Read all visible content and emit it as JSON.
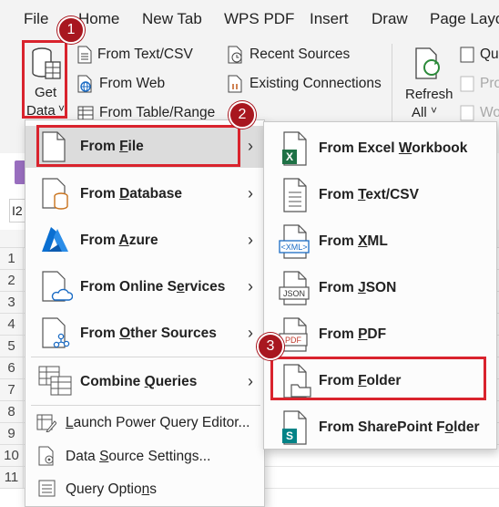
{
  "menu_tabs": [
    "File",
    "Home",
    "New Tab",
    "WPS PDF",
    "Insert",
    "Draw",
    "Page Layo"
  ],
  "ribbon": {
    "get_data": {
      "line1": "Get",
      "line2": "Data",
      "caret": "˅"
    },
    "from_text_csv": "From Text/CSV",
    "from_web": "From Web",
    "from_table_range": "From Table/Range",
    "recent_sources": "Recent Sources",
    "existing_connections": "Existing Connections",
    "refresh": {
      "line1": "Refresh",
      "line2": "All",
      "caret": "˅"
    },
    "right_items": [
      "Qu",
      "Pro",
      "Wo"
    ]
  },
  "sheet": {
    "name_box_partial": "I2",
    "row_numbers": [
      "1",
      "2",
      "3",
      "4",
      "5",
      "6",
      "7",
      "8",
      "9",
      "10",
      "11"
    ]
  },
  "get_data_menu": {
    "items": [
      {
        "pre": "From ",
        "ul": "F",
        "post": "ile"
      },
      {
        "pre": "From ",
        "ul": "D",
        "post": "atabase"
      },
      {
        "pre": "From ",
        "ul": "A",
        "post": "zure"
      },
      {
        "pre": "From Online S",
        "ul": "e",
        "post": "rvices"
      },
      {
        "pre": "From ",
        "ul": "O",
        "post": "ther Sources"
      },
      {
        "pre": "Combine ",
        "ul": "Q",
        "post": "ueries"
      }
    ],
    "bottom_items": [
      {
        "pre": "",
        "ul": "L",
        "post": "aunch Power Query Editor..."
      },
      {
        "pre": "Data ",
        "ul": "S",
        "post": "ource Settings..."
      },
      {
        "pre": "Query Optio",
        "ul": "n",
        "post": "s"
      }
    ]
  },
  "from_file_menu": {
    "items": [
      {
        "pre": "From Excel ",
        "ul": "W",
        "post": "orkbook"
      },
      {
        "pre": "From ",
        "ul": "T",
        "post": "ext/CSV"
      },
      {
        "pre": "From ",
        "ul": "X",
        "post": "ML"
      },
      {
        "pre": "From ",
        "ul": "J",
        "post": "SON"
      },
      {
        "pre": "From ",
        "ul": "P",
        "post": "DF"
      },
      {
        "pre": "From ",
        "ul": "F",
        "post": "older"
      },
      {
        "pre": "From SharePoint F",
        "ul": "o",
        "post": "lder"
      }
    ],
    "badges": {
      "xml": "<XML>",
      "json": "JSON",
      "pdf": "PDF",
      "excel": "X",
      "sharepoint": "S"
    }
  },
  "callouts": [
    "1",
    "2",
    "3"
  ],
  "colors": {
    "accent_red": "#d9232d",
    "badge_red": "#a8171f",
    "excel_green": "#1e7145",
    "azure_blue": "#0a6fd1"
  }
}
